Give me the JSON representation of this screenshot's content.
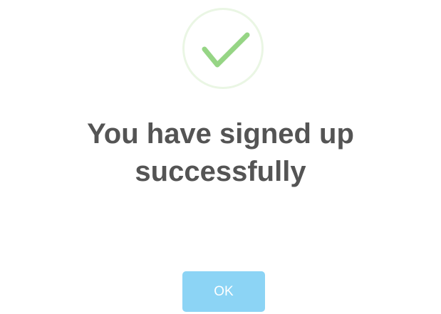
{
  "alert": {
    "icon": "checkmark-icon",
    "title_line_1": "You have signed up",
    "title_line_2": "successfully",
    "confirm_label": "OK"
  },
  "colors": {
    "check": "#96d585",
    "icon_ring": "#eaf6e4",
    "title_text": "#545454",
    "button_bg": "#8cd4f5",
    "button_text": "#ffffff"
  }
}
